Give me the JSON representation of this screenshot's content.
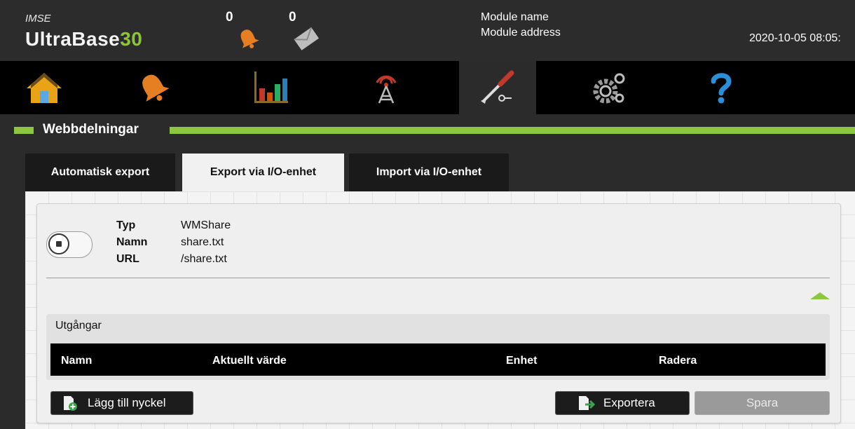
{
  "header": {
    "brand_small": "IMSE",
    "brand_main": "UltraBase",
    "brand_num": "30",
    "alarm_count": "0",
    "message_count": "0",
    "module_name": "Module name",
    "module_address": "Module address",
    "datetime": "2020-10-05 08:05:"
  },
  "nav": {
    "items": [
      "home-icon",
      "alarm-bell-icon",
      "chart-icon",
      "antenna-icon",
      "tools-icon",
      "gear-icon",
      "help-icon"
    ],
    "active": "tools-icon"
  },
  "section": {
    "title": "Webbdelningar"
  },
  "tabs": [
    {
      "label": "Automatisk export",
      "active": false
    },
    {
      "label": "Export via I/O-enhet",
      "active": true
    },
    {
      "label": "Import via I/O-enhet",
      "active": false
    }
  ],
  "share": {
    "type_label": "Typ",
    "type_value": "WMShare",
    "name_label": "Namn",
    "name_value": "share.txt",
    "url_label": "URL",
    "url_value": "/share.txt"
  },
  "outputs": {
    "title": "Utgångar",
    "columns": [
      "Namn",
      "Aktuellt värde",
      "Enhet",
      "Radera"
    ]
  },
  "buttons": {
    "add_key": "Lägg till nyckel",
    "export": "Exportera",
    "save": "Spara"
  },
  "colors": {
    "accent": "#8dc63f",
    "dark": "#2b2b2b",
    "black": "#000000"
  }
}
